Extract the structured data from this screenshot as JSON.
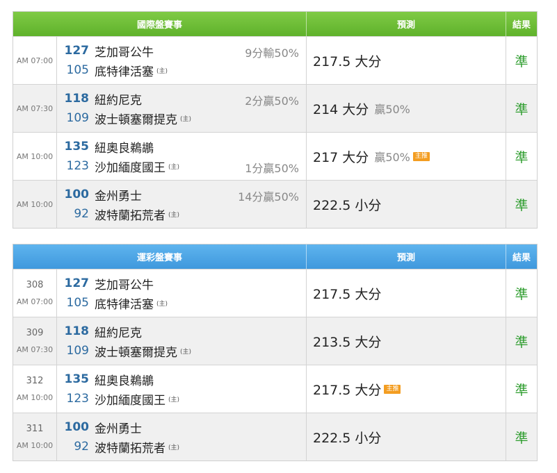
{
  "tables": [
    {
      "header": {
        "title": "國際盤賽事",
        "prediction": "預測",
        "result": "結果"
      },
      "rows": [
        {
          "time": "AM 07:00",
          "game_id": "",
          "away_score": "127",
          "away_team": "芝加哥公牛",
          "away_bold": true,
          "home_score": "105",
          "home_team": "底特律活塞",
          "home_bold": false,
          "home_mark": "(主)",
          "spread_top": "9分輸50%",
          "spread_bottom": "",
          "prediction": "217.5 大分",
          "pct": "",
          "badge": "",
          "result": "準"
        },
        {
          "time": "AM 07:30",
          "game_id": "",
          "away_score": "118",
          "away_team": "紐約尼克",
          "away_bold": true,
          "home_score": "109",
          "home_team": "波士頓塞爾提克",
          "home_bold": false,
          "home_mark": "(主)",
          "spread_top": "2分贏50%",
          "spread_bottom": "",
          "prediction": "214 大分",
          "pct": "贏50%",
          "badge": "",
          "result": "準"
        },
        {
          "time": "AM 10:00",
          "game_id": "",
          "away_score": "135",
          "away_team": "紐奧良鵜鶘",
          "away_bold": true,
          "home_score": "123",
          "home_team": "沙加緬度國王",
          "home_bold": false,
          "home_mark": "(主)",
          "spread_top": "",
          "spread_bottom": "1分贏50%",
          "prediction": "217 大分",
          "pct": "贏50%",
          "badge": "主推",
          "result": "準"
        },
        {
          "time": "AM 10:00",
          "game_id": "",
          "away_score": "100",
          "away_team": "金州勇士",
          "away_bold": true,
          "home_score": "92",
          "home_team": "波特蘭拓荒者",
          "home_bold": false,
          "home_mark": "(主)",
          "spread_top": "14分贏50%",
          "spread_bottom": "",
          "prediction": "222.5 小分",
          "pct": "",
          "badge": "",
          "result": "準"
        }
      ]
    },
    {
      "header": {
        "title": "運彩盤賽事",
        "prediction": "預測",
        "result": "結果"
      },
      "rows": [
        {
          "time": "AM 07:00",
          "game_id": "308",
          "away_score": "127",
          "away_team": "芝加哥公牛",
          "away_bold": true,
          "home_score": "105",
          "home_team": "底特律活塞",
          "home_bold": false,
          "home_mark": "(主)",
          "spread_top": "",
          "spread_bottom": "",
          "prediction": "217.5 大分",
          "pct": "",
          "badge": "",
          "result": "準"
        },
        {
          "time": "AM 07:30",
          "game_id": "309",
          "away_score": "118",
          "away_team": "紐約尼克",
          "away_bold": true,
          "home_score": "109",
          "home_team": "波士頓塞爾提克",
          "home_bold": false,
          "home_mark": "(主)",
          "spread_top": "",
          "spread_bottom": "",
          "prediction": "213.5 大分",
          "pct": "",
          "badge": "",
          "result": "準"
        },
        {
          "time": "AM 10:00",
          "game_id": "312",
          "away_score": "135",
          "away_team": "紐奧良鵜鶘",
          "away_bold": true,
          "home_score": "123",
          "home_team": "沙加緬度國王",
          "home_bold": false,
          "home_mark": "(主)",
          "spread_top": "",
          "spread_bottom": "",
          "prediction": "217.5 大分",
          "pct": "",
          "badge": "主推",
          "result": "準"
        },
        {
          "time": "AM 10:00",
          "game_id": "311",
          "away_score": "100",
          "away_team": "金州勇士",
          "away_bold": true,
          "home_score": "92",
          "home_team": "波特蘭拓荒者",
          "home_bold": false,
          "home_mark": "(主)",
          "spread_top": "",
          "spread_bottom": "",
          "prediction": "222.5 小分",
          "pct": "",
          "badge": "",
          "result": "準"
        }
      ]
    }
  ],
  "colors": {
    "international_header": "#6abd35",
    "sports_lottery_header": "#4aa6e6",
    "score_blue": "#2c6aa0",
    "result_green": "#2e9d2e",
    "badge_orange": "#f39d21"
  }
}
